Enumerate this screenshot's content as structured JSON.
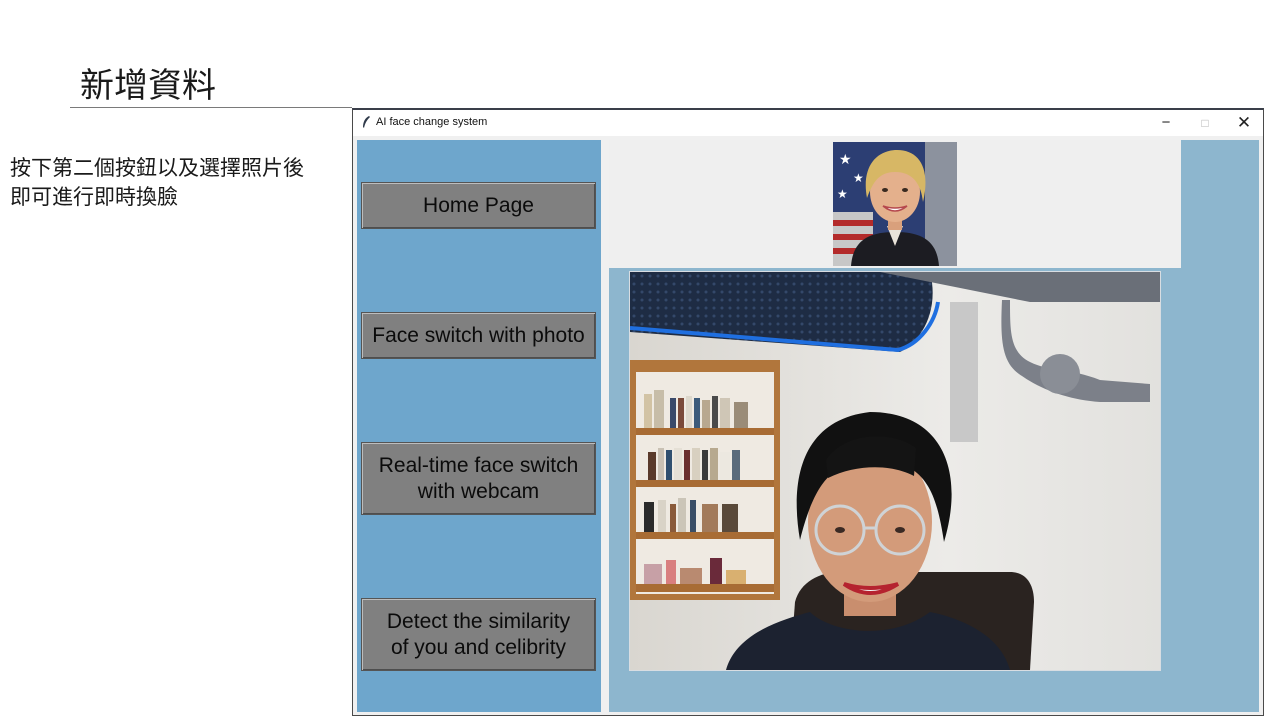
{
  "slide": {
    "title": "新增資料",
    "description_line1": "按下第二個按鈕以及選擇照片後",
    "description_line2": "即可進行即時換臉"
  },
  "window": {
    "title": "AI face change system",
    "minimize_glyph": "−",
    "maximize_glyph": "□",
    "close_glyph": "✕"
  },
  "sidebar": {
    "buttons": [
      {
        "line1": "Home Page",
        "line2": ""
      },
      {
        "line1": "Face switch with photo",
        "line2": ""
      },
      {
        "line1": "Real-time face switch",
        "line2": "with webcam"
      },
      {
        "line1": "Detect the similarity",
        "line2": "of you and celibrity"
      }
    ]
  },
  "colors": {
    "sidebar": "#6ea6cc",
    "main_panel": "#8db6ce",
    "button": "#808080"
  },
  "icons": [
    "feather-icon",
    "minimize-icon",
    "maximize-icon",
    "close-icon"
  ]
}
